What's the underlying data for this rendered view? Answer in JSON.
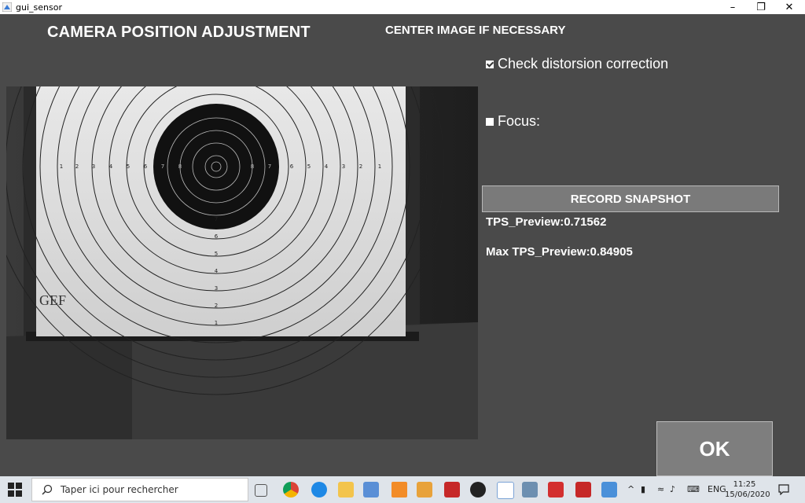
{
  "window": {
    "title": "gui_sensor"
  },
  "header": {
    "title": "CAMERA POSITION ADJUSTMENT",
    "subtitle": "CENTER IMAGE IF NECESSARY"
  },
  "options": {
    "distortion_label": "Check distorsion correction",
    "distortion_checked": true,
    "focus_label": "Focus:",
    "focus_checked": false
  },
  "preview": {
    "target_numbers_left": [
      "1",
      "2",
      "3",
      "4",
      "5",
      "6",
      "7",
      "8"
    ],
    "target_numbers_right": [
      "8",
      "7",
      "6",
      "5",
      "4",
      "3",
      "2",
      "1"
    ],
    "target_numbers_vertical": [
      "1",
      "2",
      "3",
      "4",
      "5",
      "6",
      "7"
    ],
    "brand": "GEF"
  },
  "actions": {
    "record_label": "RECORD SNAPSHOT",
    "ok_label": "OK"
  },
  "stats": {
    "tps_preview": "TPS_Preview:0.71562",
    "max_tps_preview": "Max TPS_Preview:0.84905"
  },
  "taskbar": {
    "search_placeholder": "Taper ici pour rechercher",
    "language": "ENG",
    "time": "11:25",
    "date": "15/06/2020"
  },
  "colors": {
    "background": "#4a4a4a",
    "button": "#7a7a7a",
    "taskbar": "#dfe4ea"
  }
}
